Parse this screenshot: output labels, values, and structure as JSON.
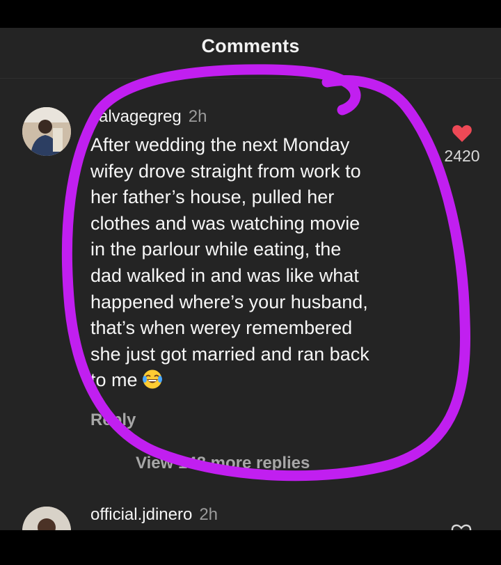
{
  "header": {
    "title": "Comments"
  },
  "comments": [
    {
      "username": "salvagegreg",
      "time": "2h",
      "text": "After wedding the next Monday\nwifey drove straight from work to\nher father’s house, pulled her\nclothes and was watching movie\nin the parlour while eating, the\ndad walked in and was like what\nhappened where’s your husband,\nthat’s when werey remembered\nshe just got married and ran back\nto me",
      "emoji": "face-with-tears-of-joy",
      "likes": "2420",
      "reply_label": "Reply",
      "view_replies_label": "View 148 more replies"
    },
    {
      "username": "official.jdinero",
      "time": "2h"
    }
  ],
  "colors": {
    "background": "#242424",
    "like_red": "#ed4956",
    "annotation_purple": "#c11ff0",
    "secondary_text": "#a7a7a7"
  },
  "icons": [
    "heart-filled-icon",
    "heart-outline-icon",
    "laughing-emoji-icon"
  ]
}
